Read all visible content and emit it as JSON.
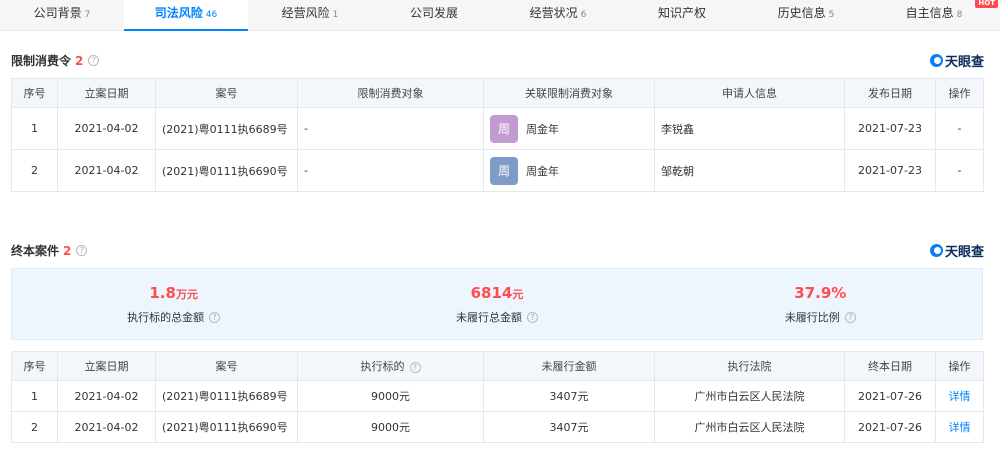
{
  "tabs": [
    {
      "label": "公司背景",
      "count": "7",
      "active": false
    },
    {
      "label": "司法风险",
      "count": "46",
      "active": true
    },
    {
      "label": "经营风险",
      "count": "1",
      "active": false
    },
    {
      "label": "公司发展",
      "count": "",
      "active": false
    },
    {
      "label": "经营状况",
      "count": "6",
      "active": false
    },
    {
      "label": "知识产权",
      "count": "",
      "active": false
    },
    {
      "label": "历史信息",
      "count": "5",
      "active": false
    },
    {
      "label": "自主信息",
      "count": "8",
      "active": false,
      "badge": "HOT"
    }
  ],
  "brand": {
    "name": "天眼查"
  },
  "restriction": {
    "title": "限制消费令",
    "count": "2",
    "help": "?",
    "columns": [
      "序号",
      "立案日期",
      "案号",
      "限制消费对象",
      "关联限制消费对象",
      "申请人信息",
      "发布日期",
      "操作"
    ],
    "rows": [
      {
        "no": "1",
        "date": "2021-04-02",
        "case": "(2021)粤0111执6689号",
        "target": "-",
        "avatar": "周",
        "avatar_color": "#c39bd3",
        "related": "周金年",
        "applicant": "李锐鑫",
        "publish": "2021-07-23",
        "action": "-"
      },
      {
        "no": "2",
        "date": "2021-04-02",
        "case": "(2021)粤0111执6690号",
        "target": "-",
        "avatar": "周",
        "avatar_color": "#7f9cc9",
        "related": "周金年",
        "applicant": "邹乾朝",
        "publish": "2021-07-23",
        "action": "-"
      }
    ]
  },
  "final_cases": {
    "title": "终本案件",
    "count": "2",
    "help": "?",
    "stats": [
      {
        "value": "1.8",
        "unit": "万元",
        "label": "执行标的总金额"
      },
      {
        "value": "6814",
        "unit": "元",
        "label": "未履行总金额"
      },
      {
        "value": "37.9%",
        "unit": "",
        "label": "未履行比例"
      }
    ],
    "columns": [
      "序号",
      "立案日期",
      "案号",
      "执行标的",
      "未履行金额",
      "执行法院",
      "终本日期",
      "操作"
    ],
    "rows": [
      {
        "no": "1",
        "date": "2021-04-02",
        "case": "(2021)粤0111执6689号",
        "amount": "9000元",
        "unpaid": "3407元",
        "court": "广州市白云区人民法院",
        "end_date": "2021-07-26",
        "action": "详情"
      },
      {
        "no": "2",
        "date": "2021-04-02",
        "case": "(2021)粤0111执6690号",
        "amount": "9000元",
        "unpaid": "3407元",
        "court": "广州市白云区人民法院",
        "end_date": "2021-07-26",
        "action": "详情"
      }
    ]
  },
  "colors": {
    "accent": "#0084ff",
    "highlight": "#ff4d4f"
  }
}
